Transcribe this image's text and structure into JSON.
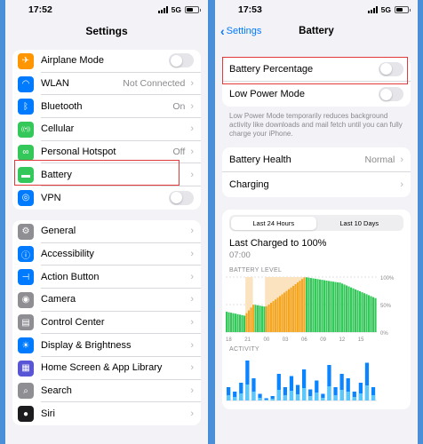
{
  "left": {
    "status": {
      "time": "17:52",
      "network": "5G"
    },
    "title": "Settings",
    "group1": [
      {
        "label": "Airplane Mode",
        "icon": "airplane-icon",
        "color": "#ff9500",
        "accessory": "toggle"
      },
      {
        "label": "WLAN",
        "value": "Not Connected",
        "icon": "wifi-icon",
        "color": "#007aff",
        "accessory": "chevron"
      },
      {
        "label": "Bluetooth",
        "value": "On",
        "icon": "bluetooth-icon",
        "color": "#007aff",
        "accessory": "chevron"
      },
      {
        "label": "Cellular",
        "icon": "cellular-icon",
        "color": "#34c759",
        "accessory": "chevron"
      },
      {
        "label": "Personal Hotspot",
        "value": "Off",
        "icon": "hotspot-icon",
        "color": "#34c759",
        "accessory": "chevron"
      },
      {
        "label": "Battery",
        "icon": "battery-icon",
        "color": "#34c759",
        "accessory": "chevron"
      },
      {
        "label": "VPN",
        "icon": "vpn-icon",
        "color": "#007aff",
        "accessory": "toggle"
      }
    ],
    "group2": [
      {
        "label": "General",
        "icon": "gear-icon",
        "color": "#8e8e93"
      },
      {
        "label": "Accessibility",
        "icon": "accessibility-icon",
        "color": "#007aff"
      },
      {
        "label": "Action Button",
        "icon": "action-button-icon",
        "color": "#007aff"
      },
      {
        "label": "Camera",
        "icon": "camera-icon",
        "color": "#8e8e93"
      },
      {
        "label": "Control Center",
        "icon": "control-center-icon",
        "color": "#8e8e93"
      },
      {
        "label": "Display & Brightness",
        "icon": "brightness-icon",
        "color": "#007aff"
      },
      {
        "label": "Home Screen & App Library",
        "icon": "home-screen-icon",
        "color": "#5856d6"
      },
      {
        "label": "Search",
        "icon": "search-icon",
        "color": "#8e8e93"
      },
      {
        "label": "Siri",
        "icon": "siri-icon",
        "color": "#1c1c1e"
      }
    ]
  },
  "right": {
    "status": {
      "time": "17:53",
      "network": "5G"
    },
    "back_label": "Settings",
    "title": "Battery",
    "battery_percentage_label": "Battery Percentage",
    "low_power_label": "Low Power Mode",
    "low_power_note": "Low Power Mode temporarily reduces background activity like downloads and mail fetch until you can fully charge your iPhone.",
    "health_label": "Battery Health",
    "health_value": "Normal",
    "charging_label": "Charging",
    "segments": [
      "Last 24 Hours",
      "Last 10 Days"
    ],
    "last_charged": "Last Charged to 100%",
    "last_charged_time": "07:00",
    "battery_level_title": "BATTERY LEVEL",
    "activity_title": "ACTIVITY",
    "pct_ticks": [
      "100%",
      "50%",
      "0%"
    ],
    "x_ticks": [
      "18",
      "21",
      "00",
      "03",
      "06",
      "09",
      "12",
      "15"
    ]
  },
  "colors": {
    "accent": "#007aff",
    "highlight": "#e23a3a",
    "charge": "#f5a623",
    "level": "#34c759",
    "activity": "#0a84ff"
  }
}
